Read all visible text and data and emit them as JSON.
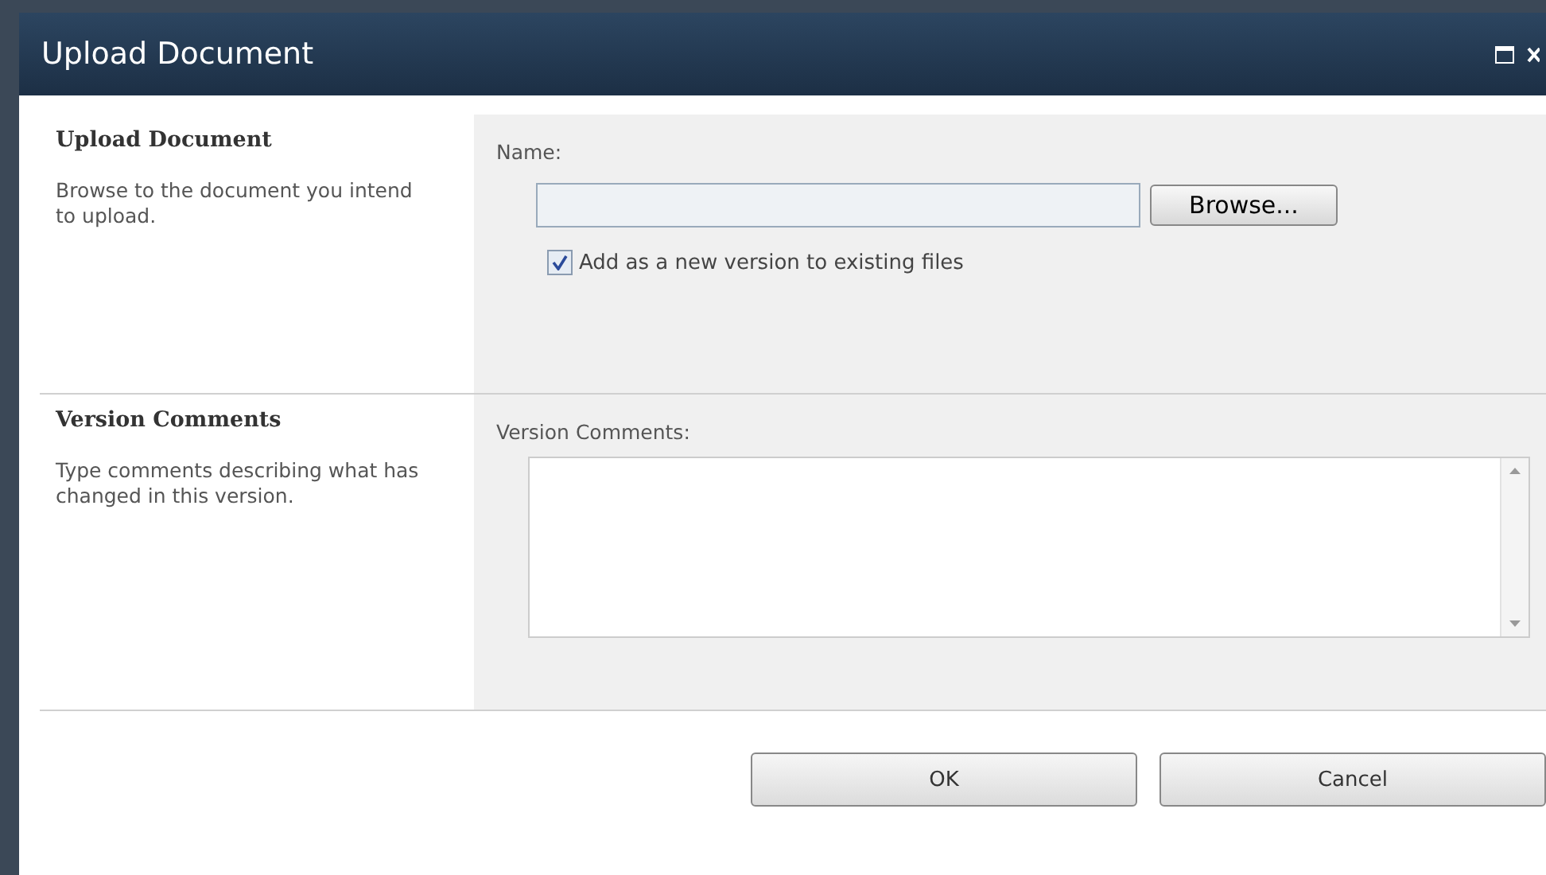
{
  "window": {
    "title": "Upload Document"
  },
  "sections": [
    {
      "heading": "Upload Document",
      "description": "Browse to the document you intend to upload.",
      "field_label": "Name:",
      "kind": "file",
      "browse_button": "Browse...",
      "checkbox": {
        "label": "Add as a new version to existing files",
        "checked": true
      }
    },
    {
      "heading": "Version Comments",
      "description": "Type comments describing what has changed in this version.",
      "field_label": "Version Comments:",
      "kind": "textarea"
    }
  ],
  "buttons": [
    "OK",
    "Cancel"
  ]
}
